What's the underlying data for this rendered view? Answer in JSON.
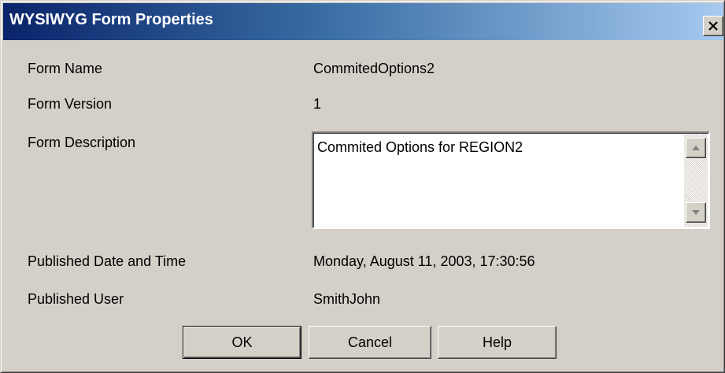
{
  "window": {
    "title": "WYSIWYG Form Properties"
  },
  "fields": {
    "form_name": {
      "label": "Form Name",
      "value": "CommitedOptions2"
    },
    "form_version": {
      "label": "Form Version",
      "value": "1"
    },
    "form_description": {
      "label": "Form Description",
      "value": "Commited Options for REGION2"
    },
    "published_date": {
      "label": "Published Date and Time",
      "value": "Monday, August 11, 2003, 17:30:56"
    },
    "published_user": {
      "label": "Published User",
      "value": "SmithJohn"
    }
  },
  "buttons": {
    "ok": "OK",
    "cancel": "Cancel",
    "help": "Help"
  },
  "icons": {
    "close": "close-icon",
    "scroll_up": "arrow-up-icon",
    "scroll_down": "arrow-down-icon"
  },
  "colors": {
    "titlebar_start": "#0a246a",
    "titlebar_end": "#a6caf0",
    "dialog_bg": "#d4d0c8"
  }
}
